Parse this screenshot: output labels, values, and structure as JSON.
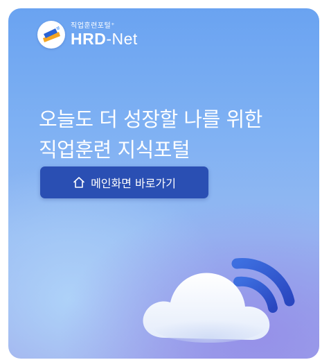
{
  "logo": {
    "sub_label": "직업훈련포털⁺",
    "brand_bold": "HRD",
    "brand_rest": "-Net",
    "mark_icon": "hrd-net-logo-icon"
  },
  "headline": {
    "line1": "오늘도 더 성장할 나를 위한",
    "line2": "직업훈련 지식포털"
  },
  "main_button": {
    "label": "메인화면 바로가기",
    "icon": "home-icon"
  },
  "illustration": {
    "icon": "cloud-wifi-icon"
  },
  "colors": {
    "button_bg": "#2a4fb3",
    "text": "#ffffff",
    "logo_orange": "#f5a623",
    "logo_blue": "#2a64d6"
  }
}
